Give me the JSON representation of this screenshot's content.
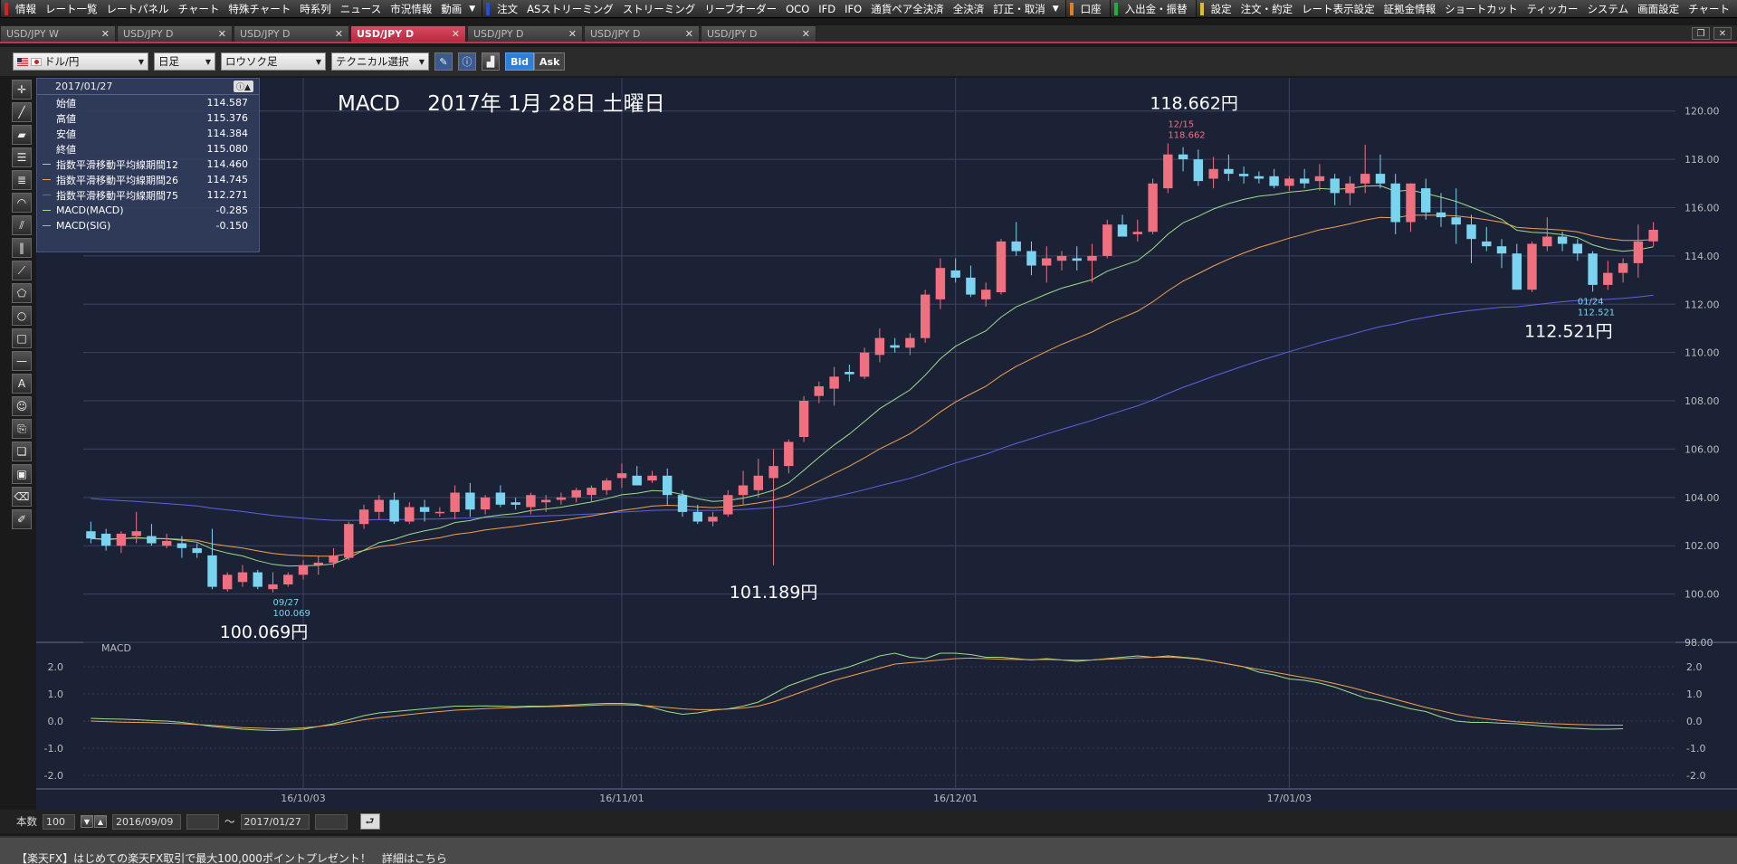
{
  "menubar": {
    "groups": [
      {
        "marker": "#e02020",
        "items": [
          "情報",
          "レート一覧",
          "レートパネル",
          "チャート",
          "特殊チャート",
          "時系列",
          "ニュース",
          "市況情報",
          "動画"
        ]
      },
      {
        "marker": "#2050e0",
        "items": [
          "注文",
          "ASストリーミング",
          "ストリーミング",
          "リーブオーダー",
          "OCO",
          "IFD",
          "IFO",
          "通貨ペア全決済",
          "全決済",
          "訂正・取消"
        ]
      },
      {
        "marker": "#e08020",
        "items": [
          "口座"
        ]
      },
      {
        "marker": "#20b040",
        "items": [
          "入出金・振替"
        ]
      },
      {
        "marker": "#e0c020",
        "items": [
          "設定",
          "注文・約定",
          "レート表示設定",
          "証拠金情報",
          "ショートカット",
          "ティッカー",
          "システム",
          "画面設定",
          "チャート"
        ]
      }
    ]
  },
  "tabs": [
    {
      "label": "USD/JPY W",
      "active": false
    },
    {
      "label": "USD/JPY D",
      "active": false
    },
    {
      "label": "USD/JPY D",
      "active": false
    },
    {
      "label": "USD/JPY D",
      "active": true
    },
    {
      "label": "USD/JPY D",
      "active": false
    },
    {
      "label": "USD/JPY D",
      "active": false
    },
    {
      "label": "USD/JPY D",
      "active": false
    }
  ],
  "toolbar": {
    "pair": "ドル/円",
    "period": "日足",
    "chart_type": "ロウソク足",
    "technical": "テクニカル選択",
    "bid": "Bid",
    "ask": "Ask"
  },
  "ohlc_panel": {
    "date": "2017/01/27",
    "rows": [
      {
        "label": "始値",
        "value": "114.587",
        "color": ""
      },
      {
        "label": "高値",
        "value": "115.376",
        "color": ""
      },
      {
        "label": "安値",
        "value": "114.384",
        "color": ""
      },
      {
        "label": "終値",
        "value": "115.080",
        "color": ""
      },
      {
        "label": "指数平滑移動平均線期間12",
        "value": "114.460",
        "color": "#9bdc8a"
      },
      {
        "label": "指数平滑移動平均線期間26",
        "value": "114.745",
        "color": "#f0a050"
      },
      {
        "label": "指数平滑移動平均線期間75",
        "value": "112.271",
        "color": "#6060e0"
      },
      {
        "label": "MACD(MACD)",
        "value": "-0.285",
        "color": "#9bdc8a"
      },
      {
        "label": "MACD(SIG)",
        "value": "-0.150",
        "color": "#f0a050"
      }
    ]
  },
  "bottom": {
    "count_label": "本数",
    "count": "100",
    "from": "2016/09/09",
    "sep": "〜",
    "to": "2017/01/27"
  },
  "ticker": "【楽天FX】はじめての楽天FX取引で最大100,000ポイントプレゼント！　詳細はこちら",
  "chart_data": {
    "type": "candlestick",
    "title": "MACD　 2017年 1月 28日 土曜日",
    "ylim": [
      98,
      121
    ],
    "yticks": [
      "98.00",
      "100.00",
      "102.00",
      "104.00",
      "106.00",
      "108.00",
      "110.00",
      "112.00",
      "114.00",
      "116.00",
      "118.00",
      "120.00"
    ],
    "xticks": [
      {
        "label": "16/10/03",
        "index": 14
      },
      {
        "label": "16/11/01",
        "index": 35
      },
      {
        "label": "16/12/01",
        "index": 57
      },
      {
        "label": "17/01/03",
        "index": 79
      }
    ],
    "ohlc": [
      [
        102.6,
        103.0,
        102.1,
        102.3
      ],
      [
        102.5,
        102.7,
        101.8,
        102.0
      ],
      [
        102.0,
        102.6,
        101.7,
        102.5
      ],
      [
        102.4,
        103.4,
        102.1,
        102.6
      ],
      [
        102.4,
        102.9,
        102.0,
        102.1
      ],
      [
        102.0,
        102.5,
        101.9,
        102.2
      ],
      [
        102.1,
        102.4,
        101.5,
        101.9
      ],
      [
        101.9,
        102.1,
        101.5,
        101.7
      ],
      [
        101.6,
        102.7,
        100.2,
        100.3
      ],
      [
        100.2,
        100.9,
        100.1,
        100.8
      ],
      [
        100.5,
        101.2,
        100.3,
        100.9
      ],
      [
        100.9,
        101.0,
        100.2,
        100.3
      ],
      [
        100.2,
        100.9,
        100.069,
        100.4
      ],
      [
        100.4,
        100.9,
        100.3,
        100.8
      ],
      [
        100.8,
        101.4,
        100.6,
        101.2
      ],
      [
        101.2,
        101.6,
        100.8,
        101.3
      ],
      [
        101.3,
        101.9,
        101.1,
        101.6
      ],
      [
        101.5,
        103.0,
        101.4,
        102.9
      ],
      [
        102.9,
        103.7,
        102.7,
        103.5
      ],
      [
        103.4,
        104.1,
        103.1,
        103.9
      ],
      [
        103.9,
        104.2,
        102.9,
        103.0
      ],
      [
        103.0,
        103.8,
        102.9,
        103.6
      ],
      [
        103.6,
        103.9,
        103.0,
        103.4
      ],
      [
        103.4,
        103.6,
        103.2,
        103.4
      ],
      [
        103.4,
        104.5,
        103.1,
        104.2
      ],
      [
        104.2,
        104.6,
        103.2,
        103.5
      ],
      [
        103.5,
        104.1,
        103.3,
        104.0
      ],
      [
        104.2,
        104.5,
        103.6,
        103.7
      ],
      [
        103.8,
        104.0,
        103.5,
        103.7
      ],
      [
        103.6,
        104.2,
        103.3,
        104.1
      ],
      [
        103.8,
        104.1,
        103.4,
        103.9
      ],
      [
        103.9,
        104.2,
        103.7,
        104.0
      ],
      [
        104.0,
        104.4,
        103.8,
        104.3
      ],
      [
        104.1,
        104.5,
        103.8,
        104.4
      ],
      [
        104.3,
        104.8,
        104.1,
        104.7
      ],
      [
        104.8,
        105.4,
        104.4,
        105.0
      ],
      [
        104.9,
        105.3,
        104.6,
        104.5
      ],
      [
        104.7,
        105.1,
        104.6,
        104.9
      ],
      [
        104.9,
        105.2,
        103.7,
        104.1
      ],
      [
        104.1,
        104.3,
        103.2,
        103.4
      ],
      [
        103.4,
        103.7,
        102.9,
        103.0
      ],
      [
        103.0,
        103.4,
        102.8,
        103.2
      ],
      [
        103.3,
        104.3,
        103.2,
        104.1
      ],
      [
        104.1,
        105.1,
        103.7,
        104.5
      ],
      [
        104.3,
        105.6,
        104.0,
        104.9
      ],
      [
        104.8,
        106.0,
        101.189,
        105.3
      ],
      [
        105.3,
        106.4,
        105.0,
        106.3
      ],
      [
        106.5,
        108.2,
        106.3,
        108.0
      ],
      [
        108.2,
        108.8,
        107.9,
        108.6
      ],
      [
        108.5,
        109.4,
        107.8,
        109.0
      ],
      [
        109.2,
        109.5,
        108.8,
        109.1
      ],
      [
        109.0,
        110.2,
        108.9,
        110.0
      ],
      [
        109.9,
        111.0,
        109.6,
        110.6
      ],
      [
        110.3,
        110.6,
        110.0,
        110.2
      ],
      [
        110.2,
        110.8,
        109.9,
        110.6
      ],
      [
        110.6,
        112.6,
        110.4,
        112.4
      ],
      [
        112.2,
        113.9,
        111.8,
        113.5
      ],
      [
        113.4,
        113.9,
        112.9,
        113.1
      ],
      [
        113.1,
        113.6,
        112.3,
        112.4
      ],
      [
        112.2,
        112.9,
        111.9,
        112.6
      ],
      [
        112.5,
        114.7,
        112.4,
        114.6
      ],
      [
        114.6,
        115.4,
        114.0,
        114.2
      ],
      [
        114.2,
        114.6,
        113.2,
        113.6
      ],
      [
        113.6,
        114.4,
        112.9,
        113.9
      ],
      [
        113.8,
        114.2,
        113.4,
        114.0
      ],
      [
        113.9,
        114.4,
        113.4,
        113.8
      ],
      [
        113.8,
        114.5,
        112.9,
        114.0
      ],
      [
        114.0,
        115.5,
        113.9,
        115.3
      ],
      [
        115.3,
        115.7,
        114.9,
        114.8
      ],
      [
        114.9,
        115.5,
        114.6,
        115.0
      ],
      [
        115.0,
        117.2,
        114.9,
        117.0
      ],
      [
        116.8,
        118.662,
        116.6,
        118.2
      ],
      [
        118.2,
        118.5,
        117.5,
        118.0
      ],
      [
        118.0,
        118.4,
        116.9,
        117.1
      ],
      [
        117.2,
        118.1,
        116.8,
        117.6
      ],
      [
        117.6,
        118.2,
        117.1,
        117.4
      ],
      [
        117.4,
        117.7,
        117.0,
        117.3
      ],
      [
        117.3,
        117.5,
        117.0,
        117.2
      ],
      [
        117.3,
        117.6,
        116.8,
        116.9
      ],
      [
        116.9,
        117.3,
        116.7,
        117.2
      ],
      [
        117.2,
        117.6,
        116.8,
        117.0
      ],
      [
        117.1,
        117.8,
        116.7,
        117.3
      ],
      [
        117.2,
        117.4,
        116.1,
        116.6
      ],
      [
        116.6,
        117.3,
        116.1,
        117.0
      ],
      [
        117.0,
        118.6,
        116.6,
        117.4
      ],
      [
        117.4,
        118.2,
        116.8,
        117.0
      ],
      [
        117.0,
        117.4,
        114.9,
        115.4
      ],
      [
        115.4,
        117.0,
        115.0,
        117.0
      ],
      [
        116.8,
        117.2,
        115.5,
        115.8
      ],
      [
        115.8,
        116.6,
        115.2,
        115.6
      ],
      [
        115.6,
        116.8,
        114.5,
        115.3
      ],
      [
        115.3,
        115.7,
        113.7,
        114.7
      ],
      [
        114.6,
        115.2,
        114.2,
        114.4
      ],
      [
        114.4,
        114.7,
        113.5,
        114.1
      ],
      [
        114.1,
        114.5,
        112.6,
        112.6
      ],
      [
        112.6,
        114.6,
        112.5,
        114.5
      ],
      [
        114.4,
        115.6,
        114.2,
        114.8
      ],
      [
        114.8,
        115.0,
        114.2,
        114.5
      ],
      [
        114.5,
        114.7,
        113.8,
        114.1
      ],
      [
        114.1,
        114.2,
        112.521,
        112.8
      ],
      [
        112.8,
        113.8,
        112.6,
        113.3
      ],
      [
        113.3,
        113.9,
        112.9,
        113.7
      ],
      [
        113.7,
        115.3,
        113.1,
        114.6
      ],
      [
        114.6,
        115.4,
        114.4,
        115.08
      ]
    ],
    "annotations": [
      {
        "text": "100.069円",
        "index": 12,
        "price": 100.069,
        "date": "09/27",
        "pos": "below"
      },
      {
        "text": "101.189円",
        "index": 45,
        "price": 101.189,
        "pos": "below"
      },
      {
        "text": "118.662円",
        "index": 71,
        "price": 118.662,
        "date": "12/15",
        "pos": "above"
      },
      {
        "text": "112.521円",
        "index": 98,
        "price": 112.521,
        "date": "01/24",
        "pos": "below"
      }
    ],
    "series_colors": {
      "up": "#f07080",
      "down": "#7ad4f0",
      "ema12": "#9bdc8a",
      "ema26": "#f0a050",
      "ema75": "#6060e0"
    },
    "macd": {
      "label": "MACD",
      "ylim": [
        -2.5,
        2.5
      ],
      "yticks": [
        "-2.0",
        "-1.0",
        "0.0",
        "1.0",
        "2.0"
      ],
      "macd": [
        0.1,
        0.08,
        0.07,
        0.05,
        0.02,
        0.0,
        -0.05,
        -0.12,
        -0.2,
        -0.25,
        -0.3,
        -0.33,
        -0.35,
        -0.33,
        -0.3,
        -0.2,
        -0.1,
        0.05,
        0.2,
        0.3,
        0.35,
        0.4,
        0.45,
        0.5,
        0.55,
        0.55,
        0.56,
        0.55,
        0.53,
        0.55,
        0.55,
        0.57,
        0.6,
        0.63,
        0.65,
        0.65,
        0.62,
        0.5,
        0.35,
        0.25,
        0.3,
        0.4,
        0.45,
        0.55,
        0.7,
        1.0,
        1.3,
        1.5,
        1.7,
        1.85,
        2.0,
        2.2,
        2.4,
        2.5,
        2.35,
        2.3,
        2.5,
        2.5,
        2.45,
        2.35,
        2.35,
        2.3,
        2.25,
        2.3,
        2.25,
        2.2,
        2.25,
        2.3,
        2.35,
        2.4,
        2.35,
        2.4,
        2.35,
        2.3,
        2.2,
        2.1,
        2.0,
        1.8,
        1.7,
        1.55,
        1.5,
        1.4,
        1.25,
        1.05,
        0.85,
        0.75,
        0.6,
        0.45,
        0.35,
        0.15,
        0.0,
        -0.05,
        -0.05,
        -0.08,
        -0.1,
        -0.15,
        -0.2,
        -0.25,
        -0.27,
        -0.3,
        -0.3,
        -0.285
      ],
      "signal": [
        0.0,
        -0.02,
        -0.04,
        -0.05,
        -0.06,
        -0.08,
        -0.1,
        -0.13,
        -0.16,
        -0.2,
        -0.24,
        -0.26,
        -0.28,
        -0.28,
        -0.25,
        -0.2,
        -0.14,
        -0.05,
        0.05,
        0.12,
        0.18,
        0.24,
        0.3,
        0.35,
        0.4,
        0.43,
        0.46,
        0.48,
        0.5,
        0.52,
        0.53,
        0.54,
        0.56,
        0.58,
        0.6,
        0.6,
        0.58,
        0.55,
        0.5,
        0.45,
        0.42,
        0.42,
        0.44,
        0.48,
        0.55,
        0.7,
        0.9,
        1.1,
        1.3,
        1.5,
        1.65,
        1.8,
        1.95,
        2.1,
        2.15,
        2.2,
        2.25,
        2.3,
        2.32,
        2.3,
        2.28,
        2.27,
        2.26,
        2.27,
        2.25,
        2.24,
        2.25,
        2.28,
        2.3,
        2.33,
        2.35,
        2.36,
        2.33,
        2.28,
        2.2,
        2.1,
        2.0,
        1.9,
        1.8,
        1.7,
        1.6,
        1.5,
        1.38,
        1.25,
        1.1,
        0.95,
        0.8,
        0.65,
        0.5,
        0.38,
        0.25,
        0.15,
        0.08,
        0.02,
        -0.03,
        -0.06,
        -0.09,
        -0.11,
        -0.13,
        -0.14,
        -0.15,
        -0.15
      ]
    }
  }
}
